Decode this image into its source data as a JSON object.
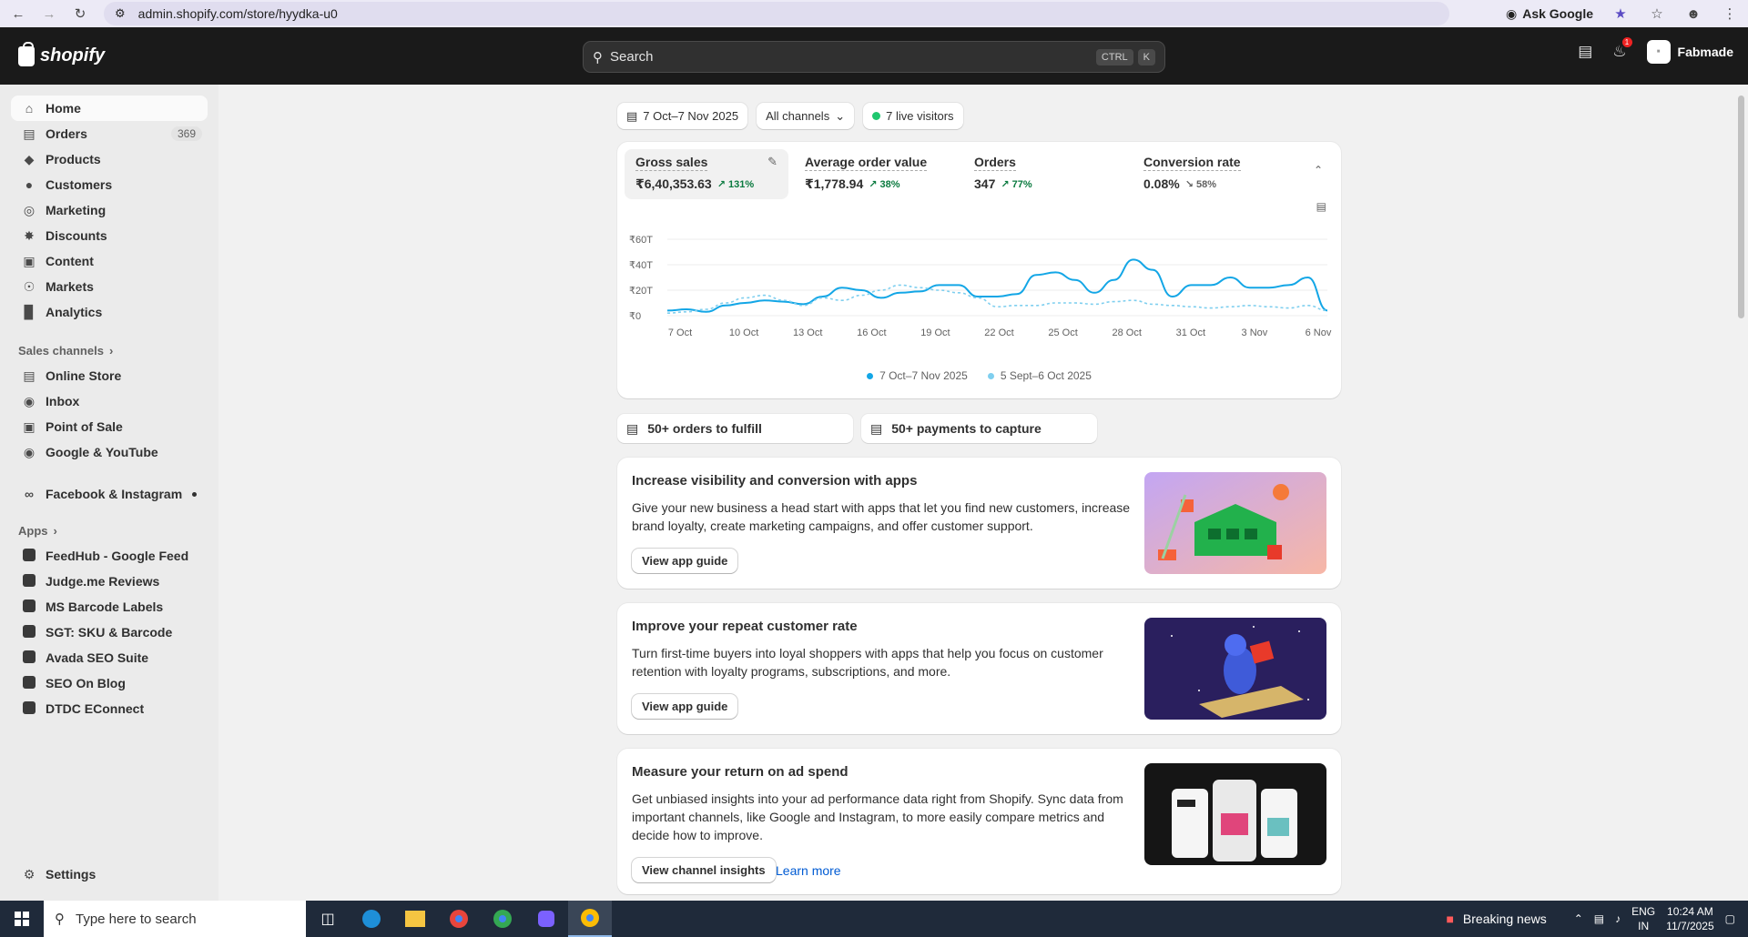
{
  "browser": {
    "url": "admin.shopify.com/store/hyydka-u0",
    "ask_google": "Ask Google"
  },
  "topbar": {
    "brand": "shopify",
    "search_placeholder": "Search",
    "shortcut_ctrl": "CTRL",
    "shortcut_k": "K",
    "notification_count": "1",
    "store_name": "Fabmade"
  },
  "sidebar": {
    "main_items": [
      {
        "label": "Home",
        "icon": "home-icon"
      },
      {
        "label": "Orders",
        "icon": "orders-icon",
        "count": "369"
      },
      {
        "label": "Products",
        "icon": "tag-icon"
      },
      {
        "label": "Customers",
        "icon": "person-icon"
      },
      {
        "label": "Marketing",
        "icon": "target-icon"
      },
      {
        "label": "Discounts",
        "icon": "discount-icon"
      },
      {
        "label": "Content",
        "icon": "content-icon"
      },
      {
        "label": "Markets",
        "icon": "globe-icon"
      },
      {
        "label": "Analytics",
        "icon": "bar-chart-icon"
      }
    ],
    "sales_channels_heading": "Sales channels",
    "sales_channels": [
      {
        "label": "Online Store"
      },
      {
        "label": "Inbox"
      },
      {
        "label": "Point of Sale"
      },
      {
        "label": "Google & YouTube"
      },
      {
        "label": "Facebook & Instagram"
      }
    ],
    "apps_heading": "Apps",
    "apps": [
      {
        "label": "FeedHub - Google Feed"
      },
      {
        "label": "Judge.me Reviews"
      },
      {
        "label": "MS Barcode Labels"
      },
      {
        "label": "SGT: SKU & Barcode"
      },
      {
        "label": "Avada SEO Suite"
      },
      {
        "label": "SEO On Blog"
      },
      {
        "label": "DTDC EConnect"
      }
    ],
    "settings": "Settings"
  },
  "filters": {
    "date_range": "7 Oct–7 Nov 2025",
    "channels": "All channels",
    "live_visitors": "7 live visitors"
  },
  "metrics": [
    {
      "label": "Gross sales",
      "value": "₹6,40,353.63",
      "change": "131%",
      "direction": "up"
    },
    {
      "label": "Average order value",
      "value": "₹1,778.94",
      "change": "38%",
      "direction": "up"
    },
    {
      "label": "Orders",
      "value": "347",
      "change": "77%",
      "direction": "up"
    },
    {
      "label": "Conversion rate",
      "value": "0.08%",
      "change": "58%",
      "direction": "down"
    }
  ],
  "chart_data": {
    "type": "line",
    "y_tick_labels": [
      "₹60T",
      "₹40T",
      "₹20T",
      "₹0"
    ],
    "ylim": [
      0,
      60
    ],
    "x_tick_labels": [
      "7 Oct",
      "10 Oct",
      "13 Oct",
      "16 Oct",
      "19 Oct",
      "22 Oct",
      "25 Oct",
      "28 Oct",
      "31 Oct",
      "3 Nov",
      "6 Nov"
    ],
    "series": [
      {
        "name": "7 Oct–7 Nov 2025",
        "color": "#13a6e6",
        "style": "solid",
        "values": [
          4,
          5,
          3,
          8,
          10,
          12,
          11,
          9,
          15,
          22,
          20,
          14,
          18,
          19,
          24,
          24,
          15,
          15,
          17,
          32,
          34,
          28,
          18,
          28,
          44,
          36,
          15,
          24,
          24,
          30,
          22,
          22,
          24,
          30,
          4
        ]
      },
      {
        "name": "5 Sept–6 Oct 2025",
        "color": "#7fcfef",
        "style": "dashed",
        "values": [
          2,
          3,
          5,
          10,
          14,
          16,
          12,
          8,
          14,
          12,
          16,
          20,
          24,
          22,
          20,
          18,
          14,
          7,
          8,
          8,
          10,
          10,
          9,
          11,
          12,
          9,
          8,
          7,
          6,
          7,
          8,
          7,
          6,
          8,
          4
        ]
      }
    ],
    "legend": "bottom"
  },
  "tasks": {
    "orders_to_fulfill": "50+ orders to fulfill",
    "payments_to_capture": "50+ payments to capture"
  },
  "promos": [
    {
      "title": "Increase visibility and conversion with apps",
      "body": "Give your new business a head start with apps that let you find new customers, increase brand loyalty, create marketing campaigns, and offer customer support.",
      "button": "View app guide"
    },
    {
      "title": "Improve your repeat customer rate",
      "body": "Turn first-time buyers into loyal shoppers with apps that help you focus on customer retention with loyalty programs, subscriptions, and more.",
      "button": "View app guide"
    },
    {
      "title": "Measure your return on ad spend",
      "body": "Get unbiased insights into your ad performance data right from Shopify. Sync data from important channels, like Google and Instagram, to more easily compare metrics and decide how to improve.",
      "button": "View channel insights",
      "link": "Learn more"
    }
  ],
  "taskbar": {
    "search_placeholder": "Type here to search",
    "news": "Breaking news",
    "lang": "ENG",
    "region": "IN",
    "time": "10:24 AM",
    "date": "11/7/2025"
  }
}
